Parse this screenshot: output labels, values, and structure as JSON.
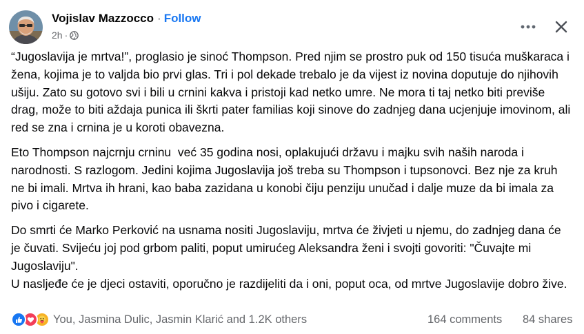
{
  "header": {
    "author_name": "Vojislav Mazzocco",
    "separator": "·",
    "follow_label": "Follow",
    "time": "2h",
    "meta_separator": "·",
    "audience_icon": "globe-icon",
    "more_icon": "more-horizontal-icon",
    "close_icon": "close-icon"
  },
  "post": {
    "paragraphs": [
      "“Jugoslavija je mrtva!”, proglasio je sinoć Thompson. Pred njim se prostro puk od 150 tisuća muškaraca i žena, kojima je to valjda bio prvi glas. Tri i pol dekade trebalo je da vijest iz novina doputuje do njihovih ušiju. Zato su gotovo svi i bili u crnini kakva i pristoji kad netko umre. Ne mora ti taj netko biti previše drag, može to biti aždaja punica ili škrti pater familias koji sinove do zadnjeg dana ucjenjuje imovinom, ali red se zna i crnina je u koroti obavezna.",
      "Eto Thompson najcrnju crninu  već 35 godina nosi, oplakujući državu i majku svih naših naroda i narodnosti. S razlogom. Jedini kojima Jugoslavija još treba su Thompson i tupsonovci. Bez nje za kruh ne bi imali. Mrtva ih hrani, kao baba zazidana u konobi čiju penziju unučad i dalje muze da bi imala za pivo i cigarete.",
      "Do smrti će Marko Perković na usnama nositi Jugoslaviju, mrtva će živjeti u njemu, do zadnjeg dana će je čuvati. Svijeću joj pod grbom paliti, poput umirućeg Aleksandra ženi i svojti govoriti: \"Čuvajte mi Jugoslaviju\".",
      "U nasljeđe će je djeci ostaviti, oporučno je razdijeliti da i oni, poput oca, od mrtve Jugoslavije dobro žive."
    ]
  },
  "footer": {
    "reaction_icons": [
      "like-icon",
      "love-icon",
      "care-icon"
    ],
    "reactors": "You, Jasmina Dulic, Jasmin Klarić and 1.2K others",
    "comments": "164 comments",
    "shares": "84 shares"
  },
  "colors": {
    "follow": "#1877f2",
    "secondary_text": "#65676b",
    "like": "#1877f2",
    "love": "#f33e58",
    "care": "#f7b125"
  }
}
